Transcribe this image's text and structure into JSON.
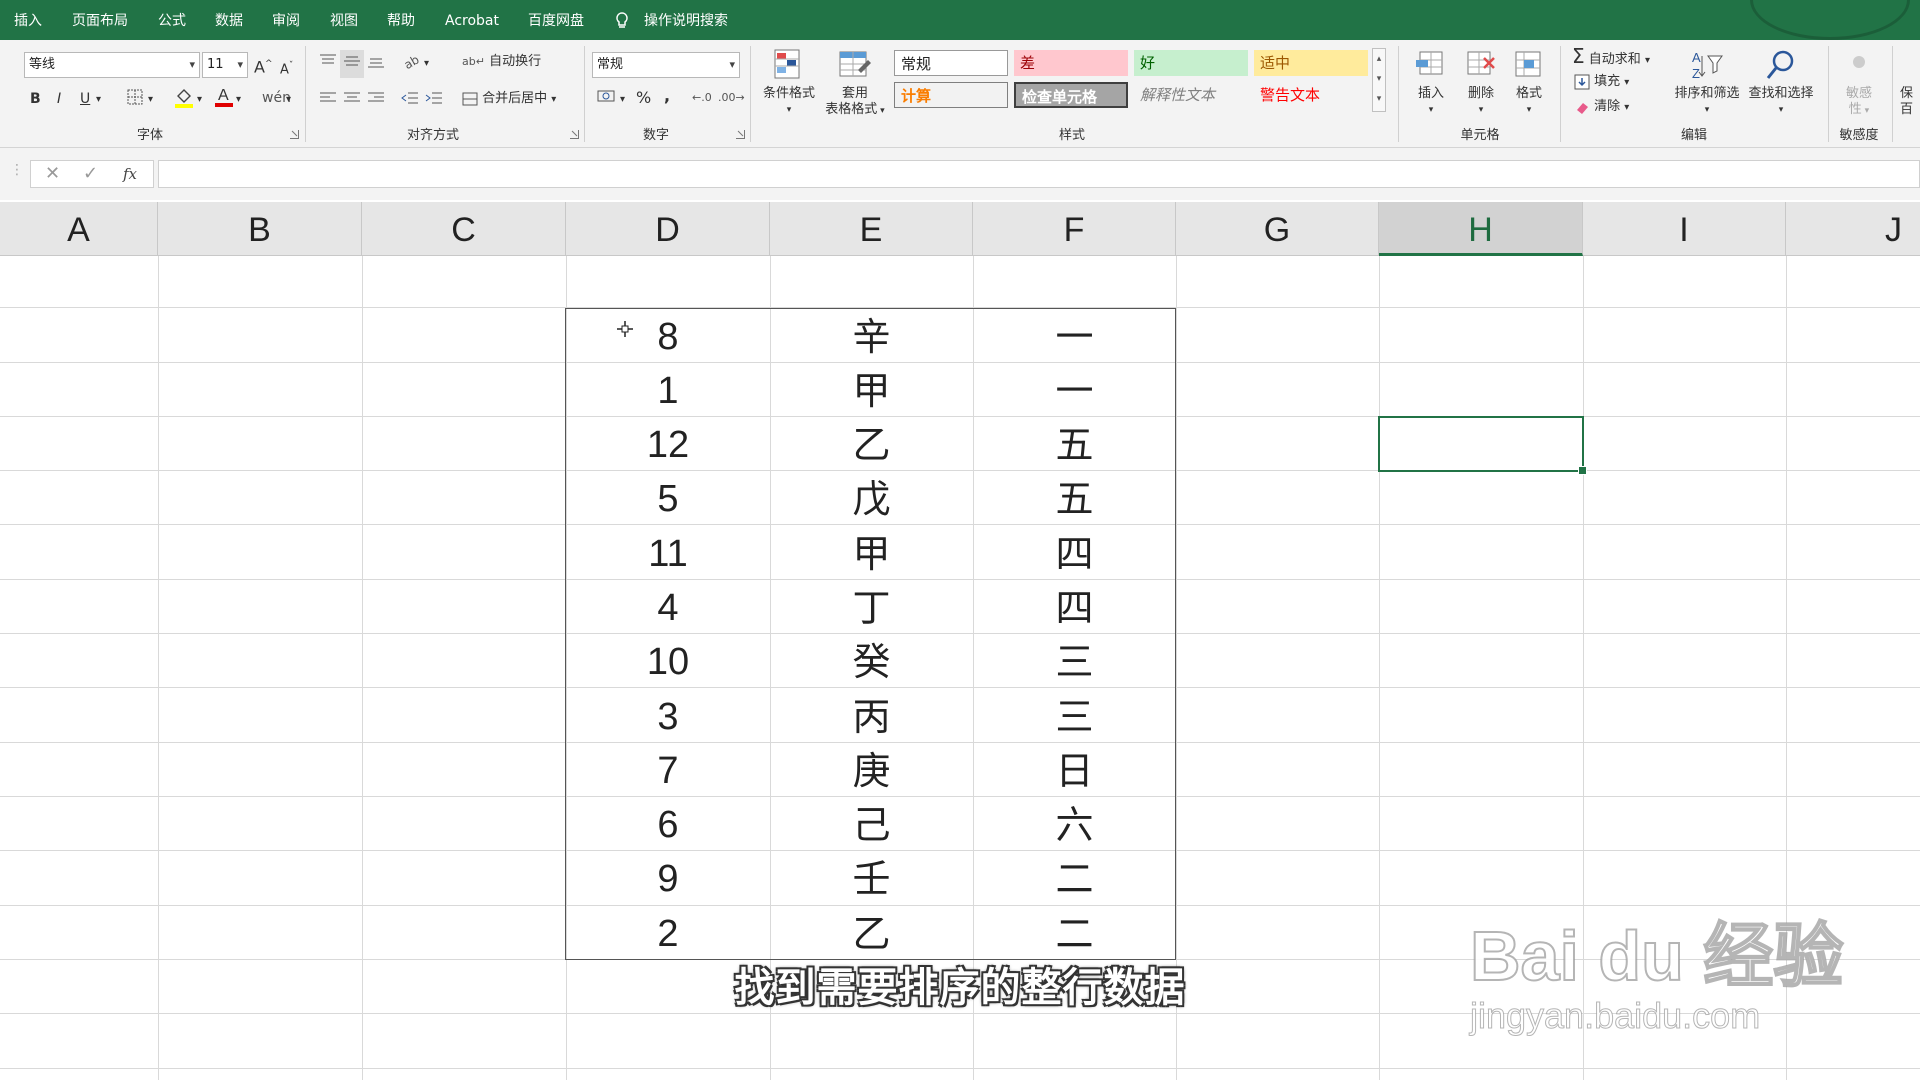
{
  "tabs": [
    "插入",
    "页面布局",
    "公式",
    "数据",
    "审阅",
    "视图",
    "帮助",
    "Acrobat",
    "百度网盘",
    "操作说明搜索"
  ],
  "ribbon": {
    "font": {
      "name": "等线",
      "size": "11",
      "bold": "B",
      "italic": "I",
      "underline": "U",
      "grow": "A",
      "shrink": "A",
      "label": "字体"
    },
    "align": {
      "wrap": "自动换行",
      "merge": "合并后居中",
      "label": "对齐方式"
    },
    "number": {
      "format": "常规",
      "percent": "%",
      "comma": ",",
      "label": "数字"
    },
    "styles": {
      "cond_format": "条件格式",
      "table_format_1": "套用",
      "table_format_2": "表格格式",
      "normal": "常规",
      "bad": "差",
      "good": "好",
      "neutral": "适中",
      "calc": "计算",
      "check": "检查单元格",
      "explain": "解释性文本",
      "warning": "警告文本",
      "label": "样式"
    },
    "cells": {
      "insert": "插入",
      "delete": "删除",
      "format": "格式",
      "label": "单元格"
    },
    "editing": {
      "autosum": "自动求和",
      "fill": "填充",
      "clear": "清除",
      "sort": "排序和筛选",
      "find": "查找和选择",
      "label": "编辑"
    },
    "sensitivity": {
      "btn_1": "敏感",
      "btn_2": "性",
      "label": "敏感度"
    },
    "cut_off": {
      "line_1": "保",
      "line_2": "百"
    }
  },
  "formula_bar": {
    "cancel": "✕",
    "enter": "✓",
    "fx": "fx",
    "value": ""
  },
  "columns": [
    "A",
    "B",
    "C",
    "D",
    "E",
    "F",
    "G",
    "H",
    "I",
    "J"
  ],
  "selected_column": "H",
  "table": {
    "rows": [
      {
        "d": "8",
        "e": "辛",
        "f": "一"
      },
      {
        "d": "1",
        "e": "甲",
        "f": "一"
      },
      {
        "d": "12",
        "e": "乙",
        "f": "五"
      },
      {
        "d": "5",
        "e": "戊",
        "f": "五"
      },
      {
        "d": "11",
        "e": "甲",
        "f": "四"
      },
      {
        "d": "4",
        "e": "丁",
        "f": "四"
      },
      {
        "d": "10",
        "e": "癸",
        "f": "三"
      },
      {
        "d": "3",
        "e": "丙",
        "f": "三"
      },
      {
        "d": "7",
        "e": "庚",
        "f": "日"
      },
      {
        "d": "6",
        "e": "己",
        "f": "六"
      },
      {
        "d": "9",
        "e": "壬",
        "f": "二"
      },
      {
        "d": "2",
        "e": "乙",
        "f": "二"
      }
    ]
  },
  "subtitle": "找到需要排序的整行数据",
  "watermark": {
    "brand": "Bai du 经验",
    "url": "jingyan.baidu.com"
  },
  "colors": {
    "accent": "#217346",
    "bad_bg": "#ffc7ce",
    "bad_fg": "#9c0006",
    "good_bg": "#c6efce",
    "good_fg": "#006100",
    "neutral_bg": "#ffeb9c",
    "neutral_fg": "#9c5700",
    "calc_fg": "#fa7d00",
    "check_bg": "#a5a5a5",
    "warning_fg": "#ff0000"
  },
  "icons": [
    "font-color-icon",
    "fill-color-icon",
    "borders-icon",
    "wrap-icon",
    "merge-icon",
    "autosum-icon",
    "fill-down-icon",
    "eraser-icon",
    "sort-filter-icon",
    "find-icon",
    "insert-cells-icon",
    "delete-cells-icon",
    "format-cells-icon",
    "conditional-format-icon",
    "table-format-icon",
    "lightbulb-icon",
    "move-cursor-icon"
  ]
}
